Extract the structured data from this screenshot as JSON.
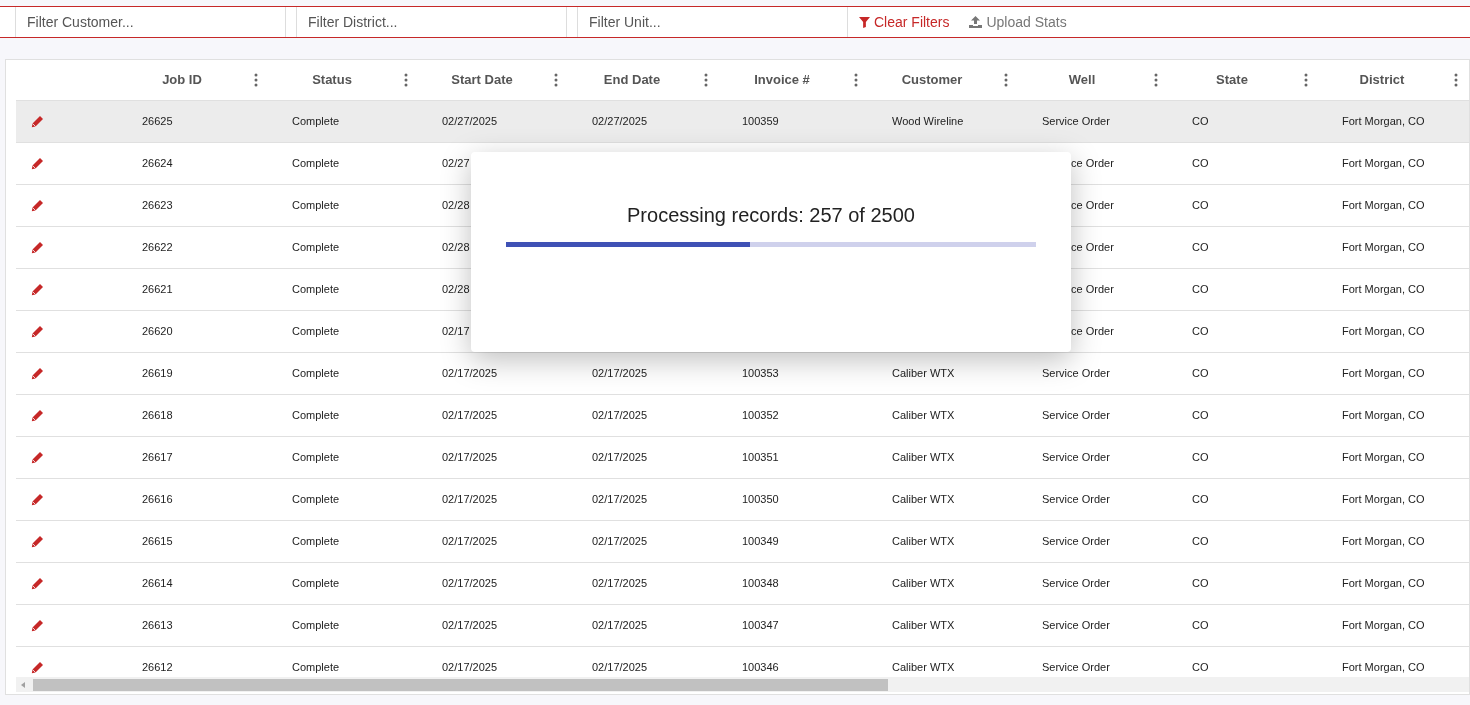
{
  "filters": [
    {
      "placeholder": "Filter Customer..."
    },
    {
      "placeholder": "Filter District..."
    },
    {
      "placeholder": "Filter Unit..."
    }
  ],
  "actions": [
    {
      "kind": "clear",
      "label": "Clear Filters"
    },
    {
      "kind": "upload",
      "label": "Upload Stats"
    }
  ],
  "table": {
    "columns": [
      "Job ID",
      "Status",
      "Start Date",
      "End Date",
      "Invoice #",
      "Customer",
      "Well",
      "State",
      "District"
    ],
    "rows": [
      {
        "selected": true,
        "cells": [
          {
            "text": "26625"
          },
          {
            "text": "Complete"
          },
          {
            "text": "02/27/2025"
          },
          {
            "text": "02/27/2025"
          },
          {
            "text": "100359"
          },
          {
            "text": "Wood Wireline"
          },
          {
            "text": "Service Order"
          },
          {
            "text": "CO"
          },
          {
            "text": "Fort Morgan, CO"
          }
        ]
      },
      {
        "selected": false,
        "cells": [
          {
            "text": "26624"
          },
          {
            "text": "Complete"
          },
          {
            "text": "02/27"
          },
          {
            "kind": "covered"
          },
          {
            "kind": "covered"
          },
          {
            "kind": "covered"
          },
          {
            "kind": "cut",
            "text": "ce Order"
          },
          {
            "text": "CO"
          },
          {
            "text": "Fort Morgan, CO"
          }
        ]
      },
      {
        "selected": false,
        "cells": [
          {
            "text": "26623"
          },
          {
            "text": "Complete"
          },
          {
            "text": "02/28"
          },
          {
            "kind": "covered"
          },
          {
            "kind": "covered"
          },
          {
            "kind": "covered"
          },
          {
            "kind": "cut",
            "text": "ce Order"
          },
          {
            "text": "CO"
          },
          {
            "text": "Fort Morgan, CO"
          }
        ]
      },
      {
        "selected": false,
        "cells": [
          {
            "text": "26622"
          },
          {
            "text": "Complete"
          },
          {
            "text": "02/28"
          },
          {
            "kind": "covered"
          },
          {
            "kind": "covered"
          },
          {
            "kind": "covered"
          },
          {
            "kind": "cut",
            "text": "ce Order"
          },
          {
            "text": "CO"
          },
          {
            "text": "Fort Morgan, CO"
          }
        ]
      },
      {
        "selected": false,
        "cells": [
          {
            "text": "26621"
          },
          {
            "text": "Complete"
          },
          {
            "text": "02/28"
          },
          {
            "kind": "covered"
          },
          {
            "kind": "covered"
          },
          {
            "kind": "covered"
          },
          {
            "kind": "cut",
            "text": "ce Order"
          },
          {
            "text": "CO"
          },
          {
            "text": "Fort Morgan, CO"
          }
        ]
      },
      {
        "selected": false,
        "cells": [
          {
            "text": "26620"
          },
          {
            "text": "Complete"
          },
          {
            "text": "02/17"
          },
          {
            "kind": "covered"
          },
          {
            "kind": "covered"
          },
          {
            "kind": "covered"
          },
          {
            "kind": "cut",
            "text": "ce Order"
          },
          {
            "text": "CO"
          },
          {
            "text": "Fort Morgan, CO"
          }
        ]
      },
      {
        "selected": false,
        "cells": [
          {
            "text": "26619"
          },
          {
            "text": "Complete"
          },
          {
            "text": "02/17/2025"
          },
          {
            "text": "02/17/2025"
          },
          {
            "text": "100353"
          },
          {
            "text": "Caliber WTX"
          },
          {
            "text": "Service Order"
          },
          {
            "text": "CO"
          },
          {
            "text": "Fort Morgan, CO"
          }
        ]
      },
      {
        "selected": false,
        "cells": [
          {
            "text": "26618"
          },
          {
            "text": "Complete"
          },
          {
            "text": "02/17/2025"
          },
          {
            "text": "02/17/2025"
          },
          {
            "text": "100352"
          },
          {
            "text": "Caliber WTX"
          },
          {
            "text": "Service Order"
          },
          {
            "text": "CO"
          },
          {
            "text": "Fort Morgan, CO"
          }
        ]
      },
      {
        "selected": false,
        "cells": [
          {
            "text": "26617"
          },
          {
            "text": "Complete"
          },
          {
            "text": "02/17/2025"
          },
          {
            "text": "02/17/2025"
          },
          {
            "text": "100351"
          },
          {
            "text": "Caliber WTX"
          },
          {
            "text": "Service Order"
          },
          {
            "text": "CO"
          },
          {
            "text": "Fort Morgan, CO"
          }
        ]
      },
      {
        "selected": false,
        "cells": [
          {
            "text": "26616"
          },
          {
            "text": "Complete"
          },
          {
            "text": "02/17/2025"
          },
          {
            "text": "02/17/2025"
          },
          {
            "text": "100350"
          },
          {
            "text": "Caliber WTX"
          },
          {
            "text": "Service Order"
          },
          {
            "text": "CO"
          },
          {
            "text": "Fort Morgan, CO"
          }
        ]
      },
      {
        "selected": false,
        "cells": [
          {
            "text": "26615"
          },
          {
            "text": "Complete"
          },
          {
            "text": "02/17/2025"
          },
          {
            "text": "02/17/2025"
          },
          {
            "text": "100349"
          },
          {
            "text": "Caliber WTX"
          },
          {
            "text": "Service Order"
          },
          {
            "text": "CO"
          },
          {
            "text": "Fort Morgan, CO"
          }
        ]
      },
      {
        "selected": false,
        "cells": [
          {
            "text": "26614"
          },
          {
            "text": "Complete"
          },
          {
            "text": "02/17/2025"
          },
          {
            "text": "02/17/2025"
          },
          {
            "text": "100348"
          },
          {
            "text": "Caliber WTX"
          },
          {
            "text": "Service Order"
          },
          {
            "text": "CO"
          },
          {
            "text": "Fort Morgan, CO"
          }
        ]
      },
      {
        "selected": false,
        "cells": [
          {
            "text": "26613"
          },
          {
            "text": "Complete"
          },
          {
            "text": "02/17/2025"
          },
          {
            "text": "02/17/2025"
          },
          {
            "text": "100347"
          },
          {
            "text": "Caliber WTX"
          },
          {
            "text": "Service Order"
          },
          {
            "text": "CO"
          },
          {
            "text": "Fort Morgan, CO"
          }
        ]
      },
      {
        "selected": false,
        "cells": [
          {
            "text": "26612"
          },
          {
            "text": "Complete"
          },
          {
            "text": "02/17/2025"
          },
          {
            "text": "02/17/2025"
          },
          {
            "text": "100346"
          },
          {
            "text": "Caliber WTX"
          },
          {
            "text": "Service Order"
          },
          {
            "text": "CO"
          },
          {
            "text": "Fort Morgan, CO"
          }
        ]
      }
    ]
  },
  "dialog": {
    "title": "Processing records: 257 of 2500",
    "level": 0.46
  }
}
